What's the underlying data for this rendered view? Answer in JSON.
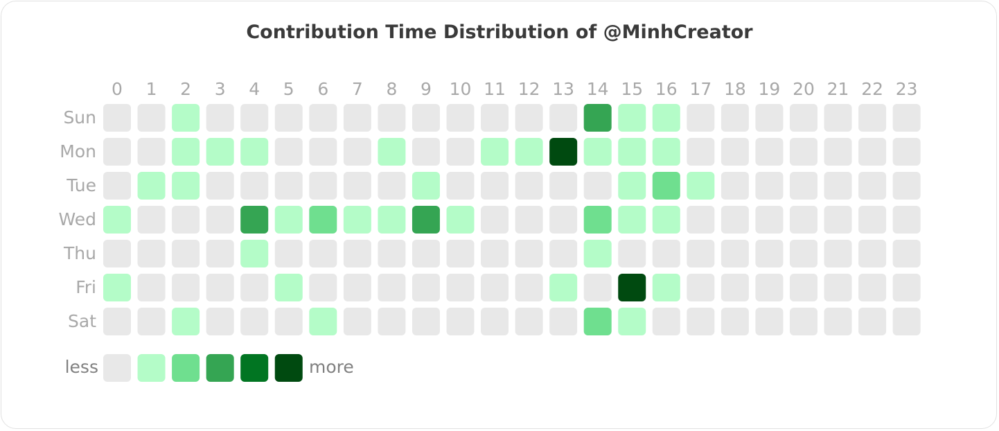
{
  "chart_data": {
    "type": "heatmap",
    "title": "Contribution Time Distribution of @MinhCreator",
    "xlabel": "",
    "ylabel": "",
    "x_categories": [
      "0",
      "1",
      "2",
      "3",
      "4",
      "5",
      "6",
      "7",
      "8",
      "9",
      "10",
      "11",
      "12",
      "13",
      "14",
      "15",
      "16",
      "17",
      "18",
      "19",
      "20",
      "21",
      "22",
      "23"
    ],
    "y_categories": [
      "Sun",
      "Mon",
      "Tue",
      "Wed",
      "Thu",
      "Fri",
      "Sat"
    ],
    "value_scale": "level 0 (none) to 5 (most)",
    "levels": [
      [
        0,
        0,
        1,
        0,
        0,
        0,
        0,
        0,
        0,
        0,
        0,
        0,
        0,
        0,
        3,
        1,
        1,
        0,
        0,
        0,
        0,
        0,
        0,
        0
      ],
      [
        0,
        0,
        1,
        1,
        1,
        0,
        0,
        0,
        1,
        0,
        0,
        1,
        1,
        5,
        1,
        1,
        1,
        0,
        0,
        0,
        0,
        0,
        0,
        0
      ],
      [
        0,
        1,
        1,
        0,
        0,
        0,
        0,
        0,
        0,
        1,
        0,
        0,
        0,
        0,
        0,
        1,
        2,
        1,
        0,
        0,
        0,
        0,
        0,
        0
      ],
      [
        1,
        0,
        0,
        0,
        3,
        1,
        2,
        1,
        1,
        3,
        1,
        0,
        0,
        0,
        2,
        1,
        1,
        0,
        0,
        0,
        0,
        0,
        0,
        0
      ],
      [
        0,
        0,
        0,
        0,
        1,
        0,
        0,
        0,
        0,
        0,
        0,
        0,
        0,
        0,
        1,
        0,
        0,
        0,
        0,
        0,
        0,
        0,
        0,
        0
      ],
      [
        1,
        0,
        0,
        0,
        0,
        1,
        0,
        0,
        0,
        0,
        0,
        0,
        0,
        1,
        0,
        5,
        1,
        0,
        0,
        0,
        0,
        0,
        0,
        0
      ],
      [
        0,
        0,
        1,
        0,
        0,
        0,
        1,
        0,
        0,
        0,
        0,
        0,
        0,
        0,
        2,
        1,
        0,
        0,
        0,
        0,
        0,
        0,
        0,
        0
      ]
    ],
    "color_scale": [
      "#e8e8e8",
      "#b4fcc8",
      "#6fdf8f",
      "#35a553",
      "#017522",
      "#004a10"
    ],
    "legend": {
      "position": "bottom-left",
      "low_label": "less",
      "high_label": "more"
    },
    "grid": false
  }
}
